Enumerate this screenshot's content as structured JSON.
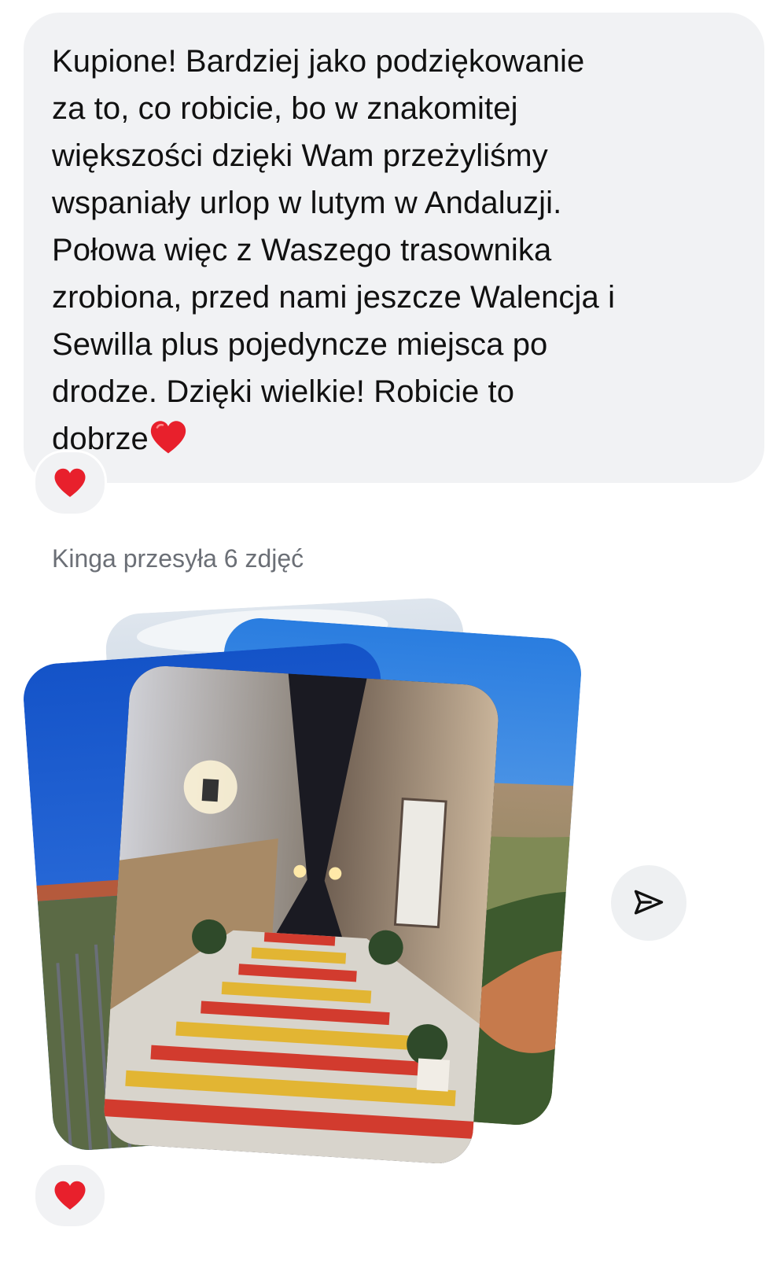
{
  "message": {
    "text": "Kupione! Bardziej jako podziękowanie\nza to, co robicie, bo w znakomitej\nwiększości dzięki Wam przeżyliśmy\nwspaniały urlop w lutym w Andaluzji.\nPołowa więc z Waszego trasownika\nzrobiona, przed nami jeszcze Walencja i\nSewilla plus pojedyncze miejsca po\ndrodze. Dzięki wielkie! Robicie to\ndobrze",
    "trailing_emoji": "heart-icon",
    "reaction": "heart-icon"
  },
  "photos": {
    "caption": "Kinga przesyła 6 zdjęć",
    "reaction": "heart-icon",
    "share_icon": "send-icon"
  },
  "colors": {
    "bubble": "#f1f2f4",
    "heart": "#e8202c",
    "caption": "#6b6f76"
  }
}
